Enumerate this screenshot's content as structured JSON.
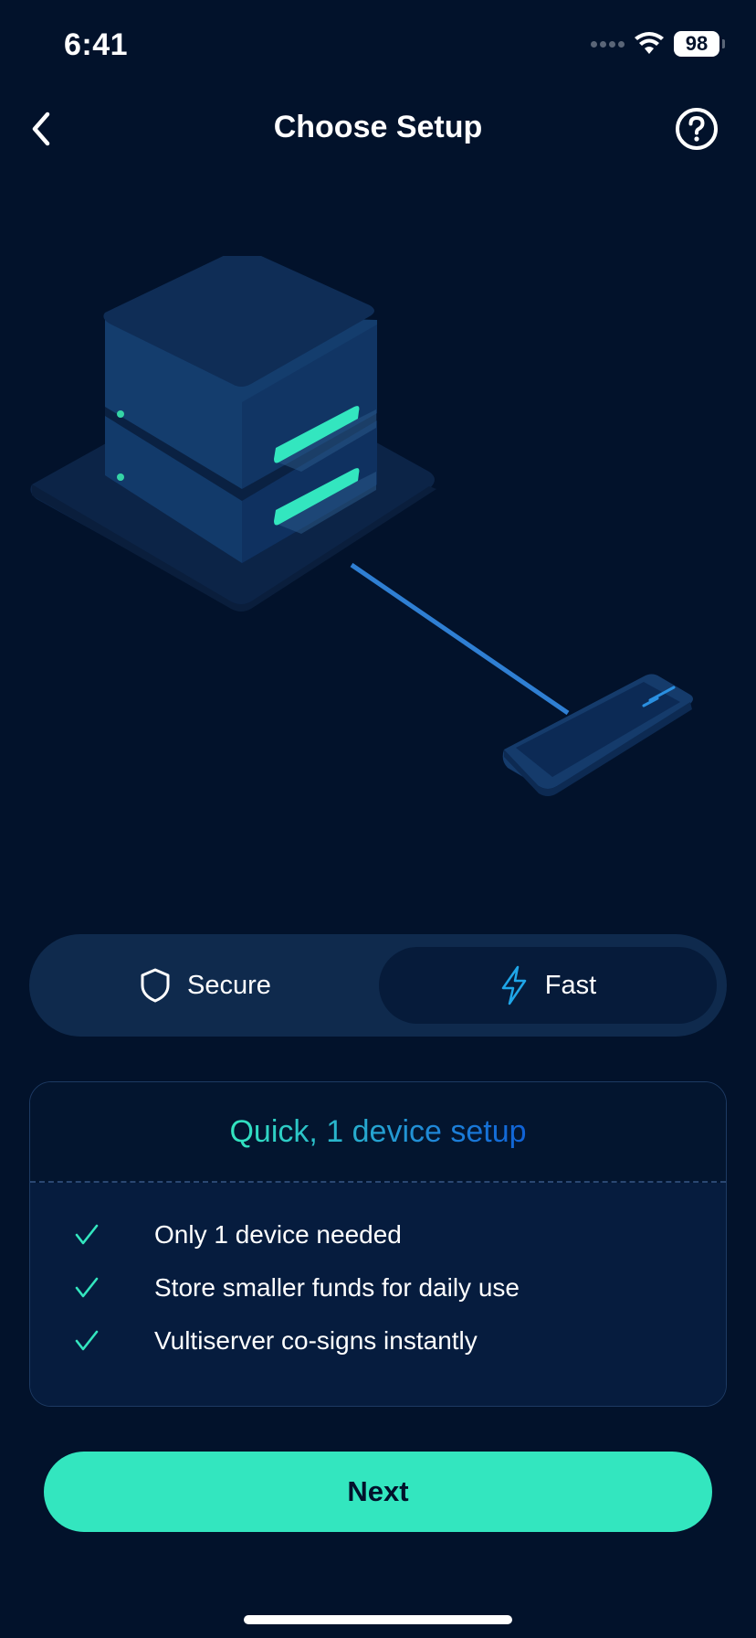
{
  "status_bar": {
    "time": "6:41",
    "battery": "98"
  },
  "header": {
    "title": "Choose Setup"
  },
  "icons": {
    "back": "chevron-left-icon",
    "help": "question-circle-icon",
    "secure": "shield-icon",
    "fast": "lightning-icon",
    "check": "check-icon"
  },
  "segmented": {
    "options": [
      {
        "label": "Secure",
        "selected": false
      },
      {
        "label": "Fast",
        "selected": true
      }
    ]
  },
  "card": {
    "title": "Quick, 1 device setup",
    "features": [
      "Only 1 device needed",
      "Store smaller funds for daily use",
      "Vultiserver co-signs instantly"
    ]
  },
  "actions": {
    "next_label": "Next"
  },
  "colors": {
    "background": "#02122b",
    "accent": "#33e6bf",
    "blue": "#1f86d8",
    "card_border": "#1d3a63"
  }
}
